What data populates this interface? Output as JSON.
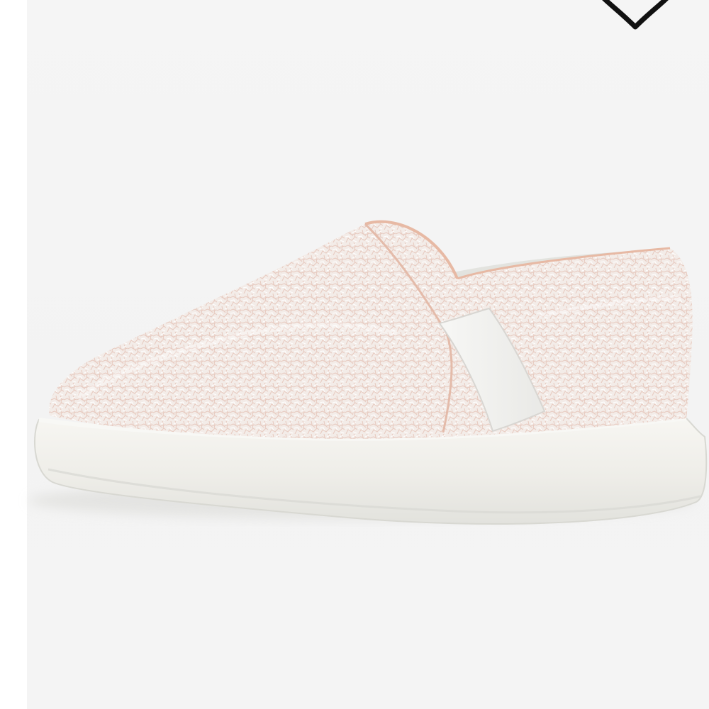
{
  "product": {
    "image": {
      "subject": "slip-on-sneaker",
      "upper_color": "#f3ece8",
      "crackle_color": "#e9c9bd",
      "piping_color": "#e7b9a4",
      "gore_color": "#f1f1ef",
      "sole_color": "#eeede8",
      "background_color": "#f4f4f4"
    },
    "favorite": {
      "icon": "heart-outline-icon",
      "color": "#111111"
    }
  }
}
